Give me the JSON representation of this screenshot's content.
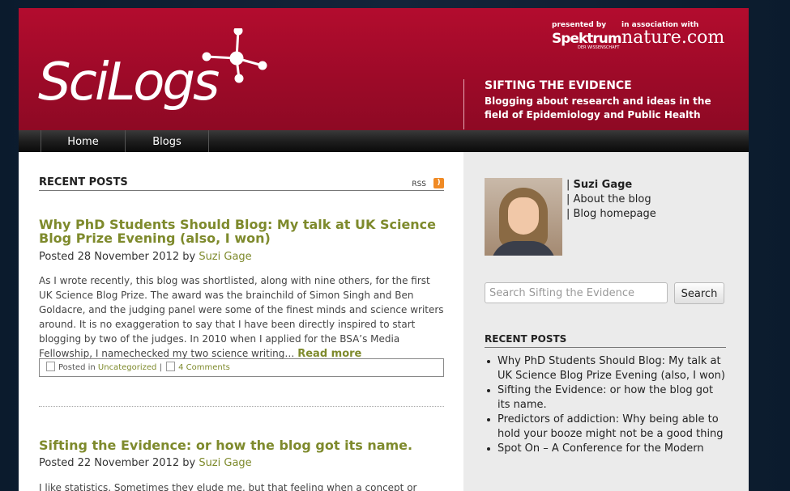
{
  "header": {
    "logo": "SciLogs",
    "presented_by": "presented by",
    "spektrum": "Spektrum",
    "spektrum_sub": "DER WISSENSCHAFT",
    "in_assoc": "in association with",
    "nature": "nature.com",
    "blog_title": "SIFTING THE EVIDENCE",
    "blog_desc": "Blogging about research and ideas in the field of Epidemiology and Public Health"
  },
  "nav": {
    "items": [
      {
        "label": "Home"
      },
      {
        "label": "Blogs"
      }
    ]
  },
  "main": {
    "section_title": "RECENT POSTS",
    "rss_label": "RSS",
    "posts": [
      {
        "title": "Why PhD Students Should Blog: My talk at UK Science Blog Prize Evening (also, I won)",
        "posted_prefix": "Posted 28 November 2012 by ",
        "author": "Suzi Gage",
        "body": "As I wrote recently, this blog was shortlisted, along with nine others, for the first UK Science Blog Prize. The award was the brainchild of Simon Singh and Ben Goldacre, and the judging panel were some of the finest minds and science writers around. It is no exaggeration to say that I have been directly inspired to start blogging by two of the judges. In 2010 when I applied for the BSA’s Media Fellowship, I namechecked my two science writing…",
        "read_more": "Read more",
        "posted_in": "Posted in",
        "category": "Uncategorized",
        "sep": "|",
        "comments": "4 Comments"
      },
      {
        "title": "Sifting the Evidence: or how the blog got its name.",
        "posted_prefix": "Posted 22 November 2012 by ",
        "author": "Suzi Gage",
        "body": "I like statistics. Sometimes they elude me, but that feeling when a concept or"
      }
    ]
  },
  "sidebar": {
    "author_name": "Suzi Gage",
    "about": "About the blog",
    "homepage": "Blog homepage",
    "search_placeholder": "Search Sifting the Evidence",
    "search_button": "Search",
    "recent_title": "RECENT POSTS",
    "recent": [
      "Why PhD Students Should Blog: My talk at UK Science Blog Prize Evening (also, I won)",
      "Sifting the Evidence: or how the blog got its name.",
      "Predictors of addiction: Why being able to hold your booze might not be a good thing",
      "Spot On – A Conference for the Modern"
    ]
  },
  "colors": {
    "header": "#a50b2b",
    "accent": "#7e8a2c",
    "sidebar": "#ebebeb"
  }
}
